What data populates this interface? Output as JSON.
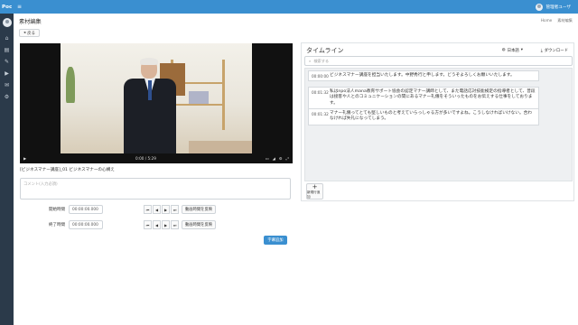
{
  "app": {
    "brand": "Poc",
    "menu_icon": "hamburger-icon",
    "user_name": "管理者ユーザ"
  },
  "sidebar": {
    "items": [
      {
        "icon": "home-icon"
      },
      {
        "icon": "book-icon"
      },
      {
        "icon": "pen-icon"
      },
      {
        "icon": "video-icon"
      },
      {
        "icon": "chat-icon"
      },
      {
        "icon": "gear-icon"
      }
    ]
  },
  "page": {
    "title": "素材編集",
    "breadcrumb": [
      "Home",
      "素材編集"
    ],
    "back_label": "戻る"
  },
  "player": {
    "time": "0:00 / 5:29"
  },
  "clip": {
    "title": "[ビジネスマナー講座]_01 ビジネスマナーの心構え",
    "comment_placeholder": "コメント(入力必須)"
  },
  "time_controls": {
    "start": {
      "label": "開始時間",
      "value": "00:00:00.000"
    },
    "end": {
      "label": "終了時間",
      "value": "00:00:00.000"
    },
    "step_buttons": [
      "⏮",
      "◀",
      "▶",
      "⏭"
    ],
    "set_label": "動画時間を反映"
  },
  "add_subtitle_label": "字幕追加",
  "timeline": {
    "title": "タイムライン",
    "language": "日本語",
    "download_label": "ダウンロード",
    "search_placeholder": "検索する",
    "entries": [
      {
        "time": "00:00:00",
        "text": "ビジネスマナー講座を担当いたします。中野秀行と申します。どうぞよろしくお願いいたします。"
      },
      {
        "time": "00:01:32",
        "text": "私はnpo法人mana教育サポート協会の認定マナー講師として、また電話応対技能検定の指導者として、普段は接客や人とのコミュニケーションの間にあるマナー礼儀をそういったものをお伝えする仕事をしております。"
      },
      {
        "time": "00:01:32",
        "text": "マナー礼儀ってとても堅しいものと考えていらっしゃる方が多いですよね。こうしなければいけない。合わなければ失礼になってしまう。"
      }
    ],
    "add_row_label": "新規行追加"
  }
}
